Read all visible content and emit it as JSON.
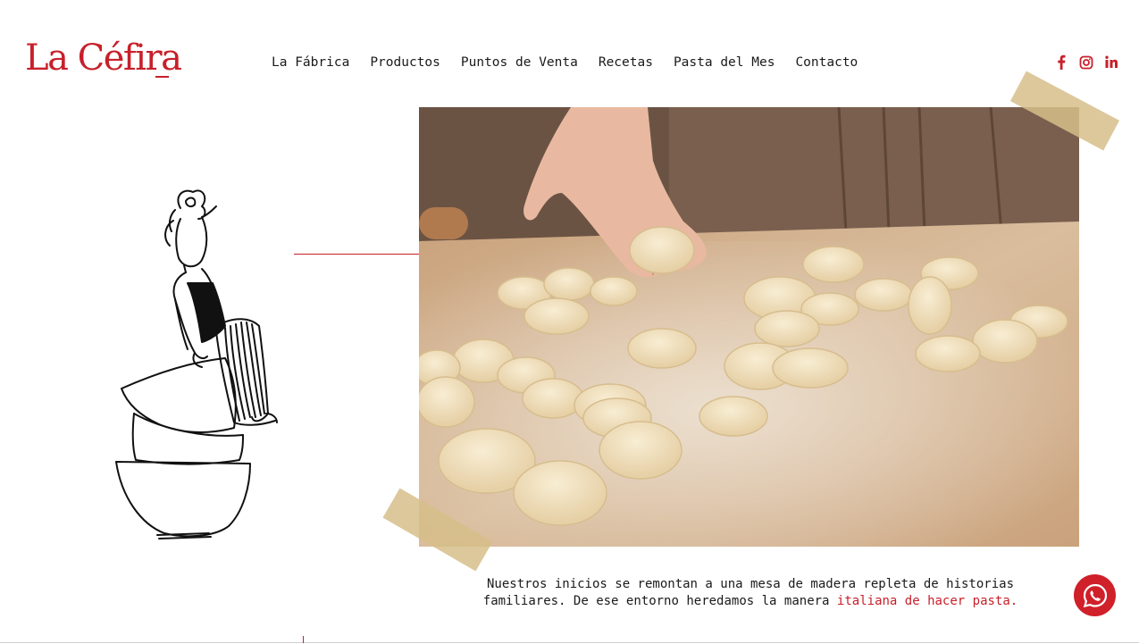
{
  "brand": {
    "logo_text": "La Céfira",
    "accent_color": "#c8202a"
  },
  "nav": {
    "items": [
      {
        "label": "La Fábrica"
      },
      {
        "label": "Productos"
      },
      {
        "label": "Puntos de Venta"
      },
      {
        "label": "Recetas"
      },
      {
        "label": "Pasta del Mes"
      },
      {
        "label": "Contacto"
      }
    ]
  },
  "social": {
    "icons": [
      "facebook-icon",
      "instagram-icon",
      "linkedin-icon"
    ]
  },
  "intro": {
    "text_main": "Nuestros inicios se remontan a una mesa de madera repleta de historias familiares. De ese entorno heredamos la manera ",
    "text_highlight": "italiana de hacer pasta."
  },
  "whatsapp": {
    "icon": "whatsapp-icon",
    "color": "#d0202a"
  }
}
